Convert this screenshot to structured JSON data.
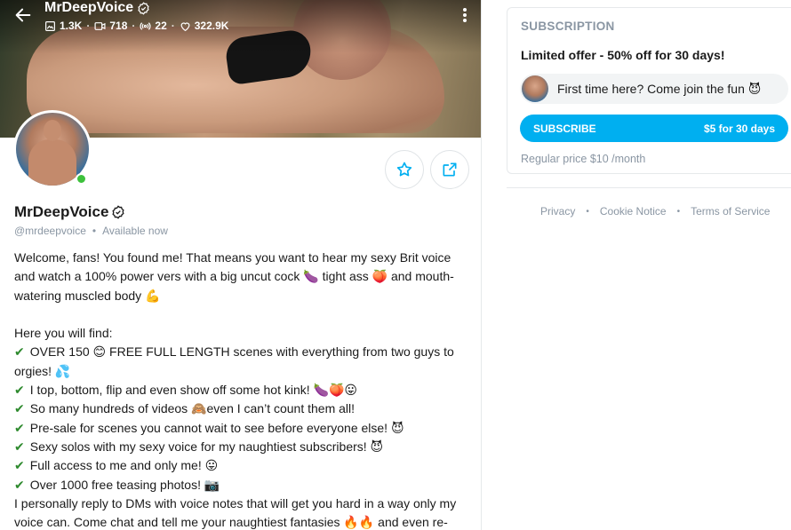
{
  "header": {
    "title": "MrDeepVoice",
    "stats": {
      "photos": "1.3K",
      "videos": "718",
      "streams": "22",
      "likes": "322.9K"
    }
  },
  "profile": {
    "name": "MrDeepVoice",
    "handle": "@mrdeepvoice",
    "status": "Available now",
    "online": true
  },
  "bio": {
    "intro": "Welcome, fans! You found me! That means you want to hear my sexy Brit voice and watch a 100% power vers with a big uncut cock 🍆 tight ass 🍑 and mouth-watering muscled body 💪",
    "list_heading": "Here you will find:",
    "items": [
      "OVER 150 😊 FREE FULL LENGTH scenes with everything from two guys to orgies! 💦",
      "I top, bottom, flip and even show off some hot kink! 🍆🍑😛",
      "So many hundreds of videos 🙈even I can’t count them all!",
      "Pre-sale for scenes you cannot wait to see before everyone else! 😈",
      "Sexy solos with my sexy voice for my naughtiest subscribers! 😈",
      "Full access to me and only me! 😛",
      "Over 1000 free teasing photos! 📷"
    ],
    "closing": "I personally reply to DMs with voice notes that will get you hard in a way only my voice can. Come chat and tell me your naughtiest fantasies 🔥🔥 and even re-"
  },
  "subscription": {
    "section_title": "SUBSCRIPTION",
    "offer": "Limited offer - 50% off for 30 days!",
    "message": "First time here? Come join the fun 😈",
    "button_label": "SUBSCRIBE",
    "button_price": "$5 for 30 days",
    "regular_price": "Regular price $10 /month"
  },
  "footer": {
    "links": [
      "Privacy",
      "Cookie Notice",
      "Terms of Service"
    ]
  },
  "colors": {
    "accent": "#00aff0",
    "online": "#3dc13c",
    "muted": "#8a96a3"
  }
}
